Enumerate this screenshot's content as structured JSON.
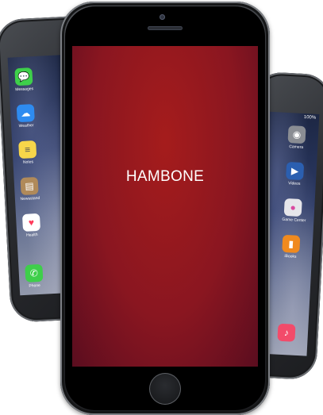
{
  "center_phone": {
    "screen_label": "HAMBONE",
    "screen_color": "#a51c1c"
  },
  "left_phone": {
    "apps": [
      {
        "label": "Messages",
        "icon": "messages-icon",
        "color": "#3ecf4a",
        "glyph": "💬"
      },
      {
        "label": "Weather",
        "icon": "weather-icon",
        "color": "#2e8bf0",
        "glyph": "☁"
      },
      {
        "label": "Notes",
        "icon": "notes-icon",
        "color": "#f7d64a",
        "glyph": "≡"
      },
      {
        "label": "Newsstand",
        "icon": "newsstand-icon",
        "color": "#b08a5a",
        "glyph": "▤"
      },
      {
        "label": "Health",
        "icon": "health-icon",
        "color": "#ffffff",
        "glyph": "♥"
      },
      {
        "label": "Phone",
        "icon": "phone-icon",
        "color": "#3ecf4a",
        "glyph": "✆"
      }
    ]
  },
  "right_phone": {
    "status_battery": "100%",
    "apps": [
      {
        "label": "Camera",
        "icon": "camera-icon",
        "color": "#8a8d93",
        "glyph": "◉"
      },
      {
        "label": "Videos",
        "icon": "videos-icon",
        "color": "#2b5fb0",
        "glyph": "▶"
      },
      {
        "label": "Game Center",
        "icon": "game-center-icon",
        "color": "#e6e6ea",
        "glyph": "●"
      },
      {
        "label": "iBooks",
        "icon": "ibooks-icon",
        "color": "#f08a1e",
        "glyph": "▮"
      },
      {
        "label": "",
        "icon": "music-icon",
        "color": "#f24b6a",
        "glyph": "♪"
      }
    ]
  }
}
